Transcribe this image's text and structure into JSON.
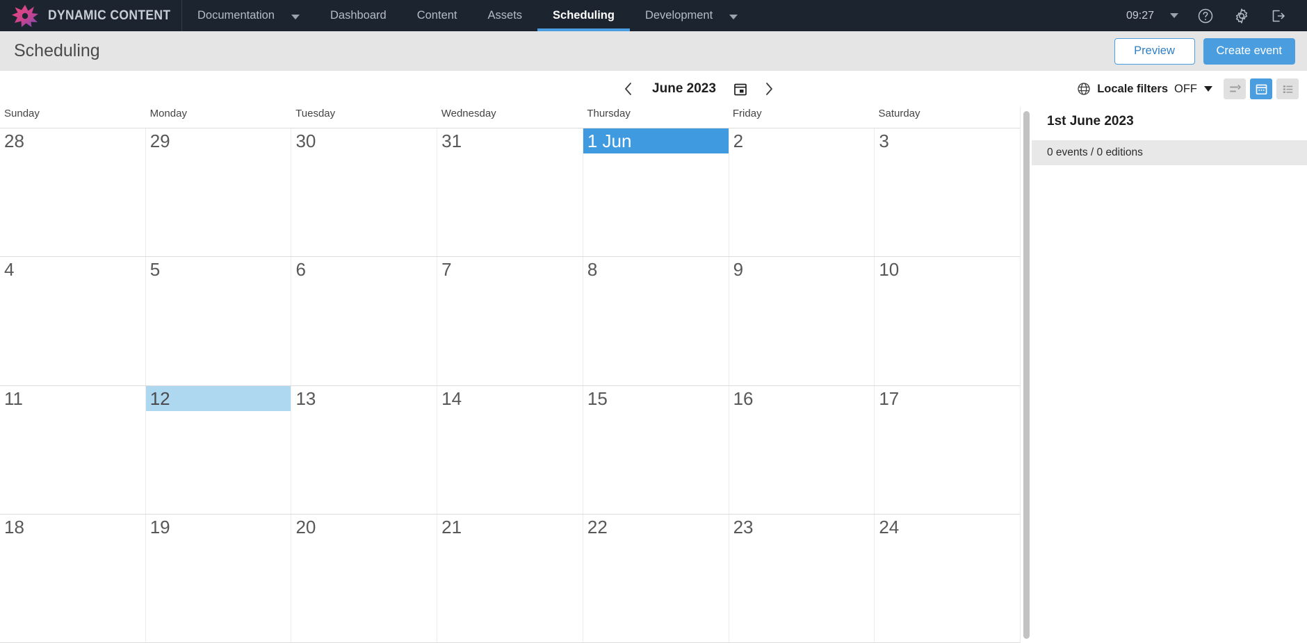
{
  "topnav": {
    "brand": "DYNAMIC CONTENT",
    "logo_icon": "starburst-logo-icon",
    "items": [
      {
        "label": "Documentation",
        "has_caret": true,
        "active": false
      },
      {
        "label": "Dashboard",
        "has_caret": false,
        "active": false
      },
      {
        "label": "Content",
        "has_caret": false,
        "active": false
      },
      {
        "label": "Assets",
        "has_caret": false,
        "active": false
      },
      {
        "label": "Scheduling",
        "has_caret": false,
        "active": true
      },
      {
        "label": "Development",
        "has_caret": true,
        "active": false
      }
    ],
    "clock": "09:27",
    "help_icon": "help-circle-icon",
    "settings_icon": "gear-icon",
    "logout_icon": "logout-icon",
    "accent_color": "#4a9ee0",
    "background_color": "#1c2430"
  },
  "subheader": {
    "title": "Scheduling",
    "preview_label": "Preview",
    "create_event_label": "Create event"
  },
  "toolbar": {
    "prev_label": "‹",
    "next_label": "›",
    "month_label": "June 2023",
    "date_picker_icon": "calendar-picker-icon",
    "globe_icon": "globe-icon",
    "locale_filters_label": "Locale filters",
    "locale_filters_value": "OFF",
    "view_timeline_icon": "timeline-view-icon",
    "view_calendar_icon": "calendar-view-icon",
    "view_list_icon": "list-view-icon",
    "active_view": "calendar"
  },
  "calendar": {
    "daynames": [
      "Sunday",
      "Monday",
      "Tuesday",
      "Wednesday",
      "Thursday",
      "Friday",
      "Saturday"
    ],
    "selected_color": "#3f9ae0",
    "today_color": "#aed8ef",
    "weeks": [
      [
        {
          "label": "28",
          "state": "normal"
        },
        {
          "label": "29",
          "state": "normal"
        },
        {
          "label": "30",
          "state": "normal"
        },
        {
          "label": "31",
          "state": "normal"
        },
        {
          "label": "1 Jun",
          "state": "selected"
        },
        {
          "label": "2",
          "state": "normal"
        },
        {
          "label": "3",
          "state": "normal"
        }
      ],
      [
        {
          "label": "4",
          "state": "normal"
        },
        {
          "label": "5",
          "state": "normal"
        },
        {
          "label": "6",
          "state": "normal"
        },
        {
          "label": "7",
          "state": "normal"
        },
        {
          "label": "8",
          "state": "normal"
        },
        {
          "label": "9",
          "state": "normal"
        },
        {
          "label": "10",
          "state": "normal"
        }
      ],
      [
        {
          "label": "11",
          "state": "normal"
        },
        {
          "label": "12",
          "state": "today"
        },
        {
          "label": "13",
          "state": "normal"
        },
        {
          "label": "14",
          "state": "normal"
        },
        {
          "label": "15",
          "state": "normal"
        },
        {
          "label": "16",
          "state": "normal"
        },
        {
          "label": "17",
          "state": "normal"
        }
      ],
      [
        {
          "label": "18",
          "state": "normal"
        },
        {
          "label": "19",
          "state": "normal"
        },
        {
          "label": "20",
          "state": "normal"
        },
        {
          "label": "21",
          "state": "normal"
        },
        {
          "label": "22",
          "state": "normal"
        },
        {
          "label": "23",
          "state": "normal"
        },
        {
          "label": "24",
          "state": "normal"
        }
      ]
    ]
  },
  "sidepanel": {
    "title": "1st June 2023",
    "summary": "0 events / 0 editions"
  }
}
